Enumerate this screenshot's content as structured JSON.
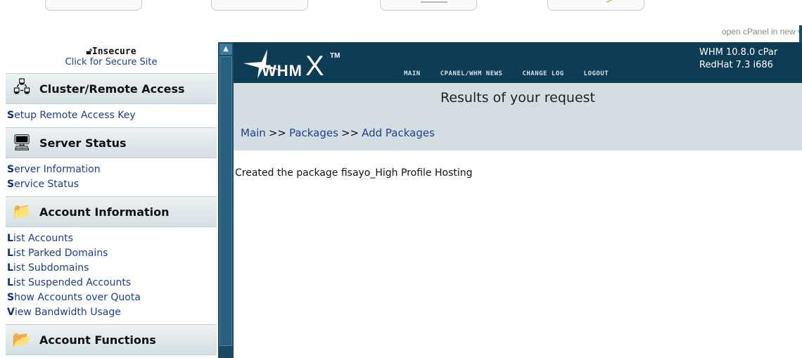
{
  "top": {
    "open_cpanel_text": "open cPanel in new v"
  },
  "sidebar": {
    "secure_title": "Insecure",
    "secure_link": "Click for Secure Site",
    "sections": [
      {
        "title": "Cluster/Remote Access",
        "icon": "network-icon",
        "links": [
          {
            "first": "S",
            "rest": "etup Remote Access Key"
          }
        ]
      },
      {
        "title": "Server Status",
        "icon": "server-icon",
        "links": [
          {
            "first": "S",
            "rest": "erver Information"
          },
          {
            "first": "S",
            "rest": "ervice Status"
          }
        ]
      },
      {
        "title": "Account Information",
        "icon": "account-info-icon",
        "links": [
          {
            "first": "L",
            "rest": "ist Accounts"
          },
          {
            "first": "L",
            "rest": "ist Parked Domains"
          },
          {
            "first": "L",
            "rest": "ist Subdomains"
          },
          {
            "first": "L",
            "rest": "ist Suspended Accounts"
          },
          {
            "first": "S",
            "rest": "how Accounts over Quota"
          },
          {
            "first": "V",
            "rest": "iew Bandwidth Usage"
          }
        ]
      },
      {
        "title": "Account Functions",
        "icon": "account-functions-icon",
        "links": []
      }
    ]
  },
  "header": {
    "logo_whm": "WHM",
    "logo_x": "X",
    "logo_tm": "TM",
    "nav": [
      "MAIN",
      "CPANEL/WHM NEWS",
      "CHANGE LOG",
      "LOGOUT"
    ],
    "version_line1": "WHM 10.8.0 cPar",
    "version_line2": "RedHat 7.3 i686"
  },
  "content": {
    "title": "Results of your request",
    "breadcrumb": [
      "Main",
      "Packages",
      "Add Packages"
    ],
    "separator": ">>",
    "message": "Created the package fisayo_High Profile Hosting"
  },
  "colors": {
    "header_bg": "#0f3c55",
    "scrollbar": "#1c4a66",
    "link": "#1f3f8f",
    "content_bar": "#d4dee2"
  }
}
